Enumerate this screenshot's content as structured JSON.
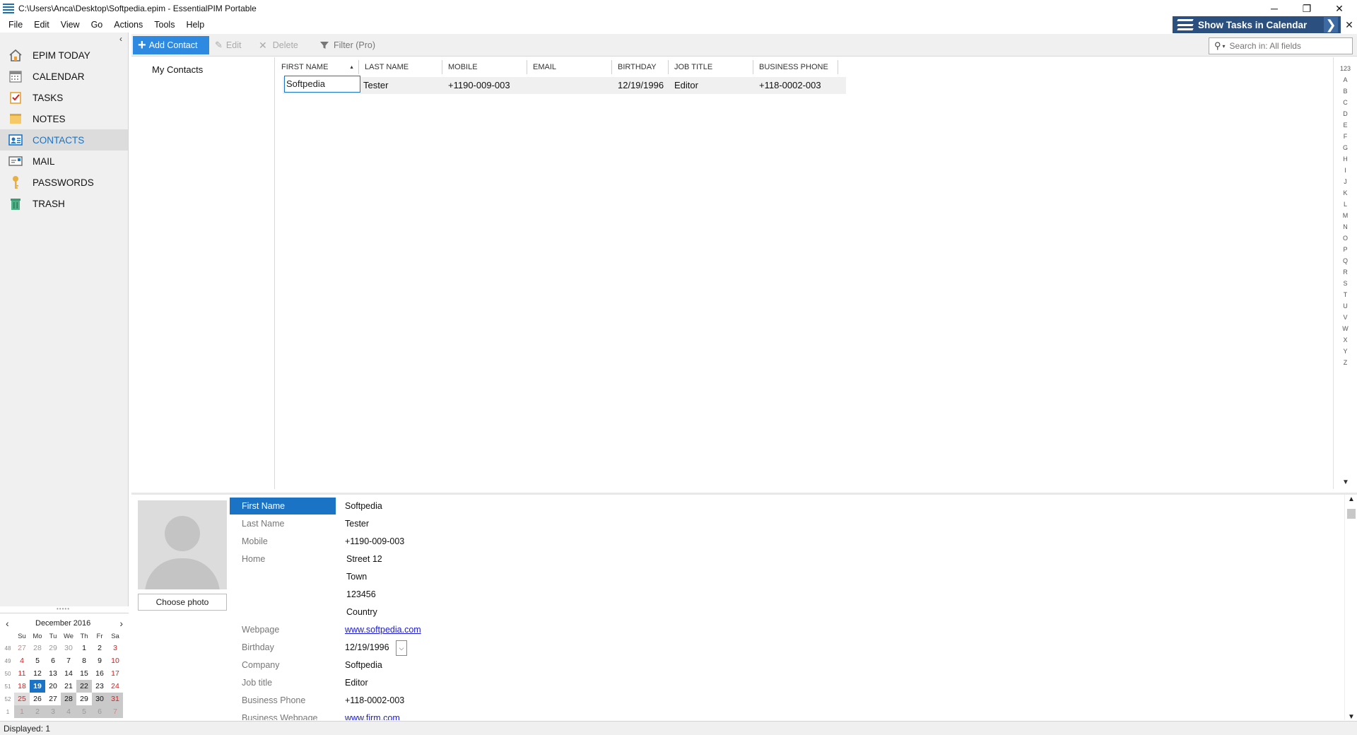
{
  "window": {
    "title": "C:\\Users\\Anca\\Desktop\\Softpedia.epim - EssentialPIM Portable",
    "minimize": "─",
    "restore": "❐",
    "close": "✕"
  },
  "menu": [
    "File",
    "Edit",
    "View",
    "Go",
    "Actions",
    "Tools",
    "Help"
  ],
  "show_tasks": {
    "label": "Show Tasks in Calendar",
    "chevron": "❯",
    "close": "✕"
  },
  "sidebar": {
    "collapse": "‹",
    "items": [
      {
        "label": "EPIM TODAY",
        "icon": "home-icon"
      },
      {
        "label": "CALENDAR",
        "icon": "calendar-icon"
      },
      {
        "label": "TASKS",
        "icon": "tasks-icon"
      },
      {
        "label": "NOTES",
        "icon": "notes-icon"
      },
      {
        "label": "CONTACTS",
        "icon": "contacts-icon",
        "active": true
      },
      {
        "label": "MAIL",
        "icon": "mail-icon"
      },
      {
        "label": "PASSWORDS",
        "icon": "key-icon"
      },
      {
        "label": "TRASH",
        "icon": "trash-icon"
      }
    ]
  },
  "minical": {
    "title": "December  2016",
    "prev": "‹",
    "next": "›",
    "weekdays": [
      "Su",
      "Mo",
      "Tu",
      "We",
      "Th",
      "Fr",
      "Sa"
    ],
    "weeks": [
      {
        "wk": "48",
        "days": [
          "27",
          "28",
          "29",
          "30",
          "1",
          "2",
          "3"
        ]
      },
      {
        "wk": "49",
        "days": [
          "4",
          "5",
          "6",
          "7",
          "8",
          "9",
          "10"
        ]
      },
      {
        "wk": "50",
        "days": [
          "11",
          "12",
          "13",
          "14",
          "15",
          "16",
          "17"
        ]
      },
      {
        "wk": "51",
        "days": [
          "18",
          "19",
          "20",
          "21",
          "22",
          "23",
          "24"
        ]
      },
      {
        "wk": "52",
        "days": [
          "25",
          "26",
          "27",
          "28",
          "29",
          "30",
          "31"
        ]
      },
      {
        "wk": "1",
        "days": [
          "1",
          "2",
          "3",
          "4",
          "5",
          "6",
          "7"
        ]
      }
    ],
    "today": "19"
  },
  "status": {
    "text": "Displayed: 1"
  },
  "toolbar": {
    "add": "Add Contact",
    "edit": "Edit",
    "delete": "Delete",
    "filter": "Filter (Pro)",
    "search_placeholder": "Search in: All fields"
  },
  "groups": {
    "item": "My Contacts"
  },
  "list": {
    "columns": [
      "FIRST NAME",
      "LAST NAME",
      "MOBILE",
      "EMAIL",
      "BIRTHDAY",
      "JOB TITLE",
      "BUSINESS PHONE"
    ],
    "sort_indicator": "▲",
    "rows": [
      {
        "first": "Softpedia",
        "last": "Tester",
        "mobile": "+1190-009-003",
        "email": "",
        "birthday": "12/19/1996",
        "job": "Editor",
        "bphone": "+118-0002-003"
      }
    ]
  },
  "alpha": [
    "123",
    "A",
    "B",
    "C",
    "D",
    "E",
    "F",
    "G",
    "H",
    "I",
    "J",
    "K",
    "L",
    "M",
    "N",
    "O",
    "P",
    "Q",
    "R",
    "S",
    "T",
    "U",
    "V",
    "W",
    "X",
    "Y",
    "Z"
  ],
  "detail": {
    "choose_photo": "Choose photo",
    "fields": {
      "first_name": {
        "label": "First Name",
        "value": "Softpedia"
      },
      "last_name": {
        "label": "Last Name",
        "value": "Tester"
      },
      "mobile": {
        "label": "Mobile",
        "value": "+1190-009-003"
      },
      "home": {
        "label": "Home",
        "street": "Street 12",
        "town": "Town",
        "zip": "123456",
        "country": "Country"
      },
      "webpage": {
        "label": "Webpage",
        "value": "www.softpedia.com"
      },
      "birthday": {
        "label": "Birthday",
        "value": "12/19/1996"
      },
      "company": {
        "label": "Company",
        "value": "Softpedia"
      },
      "job_title": {
        "label": "Job title",
        "value": "Editor"
      },
      "business_phone": {
        "label": "Business Phone",
        "value": "+118-0002-003"
      },
      "business_webpage": {
        "label": "Business Webpage",
        "value": "www.firm.com"
      }
    }
  },
  "colors": {
    "accent": "#1a73c4",
    "tasks_bar": "#2b4f7e",
    "add_button": "#2d8ae0",
    "weekend": "#d42020"
  }
}
